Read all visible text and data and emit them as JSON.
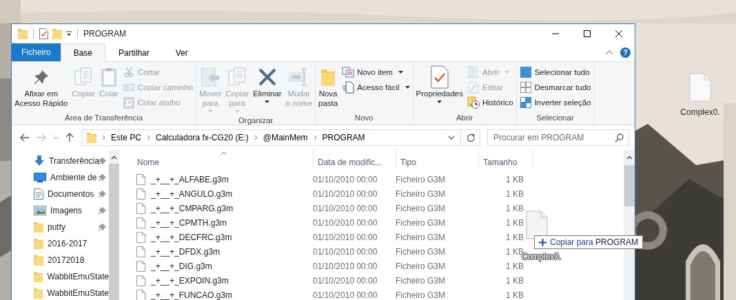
{
  "window": {
    "title": "PROGRAM"
  },
  "ribbon_tabs": [
    {
      "label": "Ficheiro",
      "kind": "file",
      "selected": false
    },
    {
      "label": "Base",
      "kind": "tab",
      "selected": true
    },
    {
      "label": "Partilhar",
      "kind": "tab",
      "selected": false
    },
    {
      "label": "Ver",
      "kind": "tab",
      "selected": false
    }
  ],
  "help": {
    "label": "?"
  },
  "ribbon_groups": [
    {
      "label": "Área de Transferência",
      "items": [
        {
          "kind": "large",
          "label": "Afixar em\nAcesso Rápido",
          "disabled": false,
          "dropdown": false
        },
        {
          "kind": "large",
          "label": "Copiar",
          "disabled": true,
          "dropdown": false
        },
        {
          "kind": "large",
          "label": "Colar",
          "disabled": true,
          "dropdown": false
        },
        {
          "kind": "small",
          "label": "Cortar",
          "disabled": true,
          "dropdown": false
        },
        {
          "kind": "small",
          "label": "Copiar caminho",
          "disabled": true,
          "dropdown": false
        },
        {
          "kind": "small",
          "label": "Colar atalho",
          "disabled": true,
          "dropdown": false
        }
      ]
    },
    {
      "label": "Organizar",
      "items": [
        {
          "kind": "large",
          "label": "Mover\npara",
          "disabled": true,
          "dropdown": true
        },
        {
          "kind": "large",
          "label": "Copiar\npara",
          "disabled": true,
          "dropdown": true
        },
        {
          "kind": "large",
          "label": "Eliminar",
          "disabled": false,
          "dropdown": true
        },
        {
          "kind": "large",
          "label": "Mudar\no nome",
          "disabled": true,
          "dropdown": false
        }
      ]
    },
    {
      "label": "Novo",
      "items": [
        {
          "kind": "large",
          "label": "Nova\npasta",
          "disabled": false,
          "dropdown": false
        },
        {
          "kind": "small",
          "label": "Novo item",
          "disabled": false,
          "dropdown": true
        },
        {
          "kind": "small",
          "label": "Acesso fácil",
          "disabled": false,
          "dropdown": true
        }
      ]
    },
    {
      "label": "Abrir",
      "items": [
        {
          "kind": "large",
          "label": "Propriedades",
          "disabled": false,
          "dropdown": true
        },
        {
          "kind": "small",
          "label": "Abrir",
          "disabled": true,
          "dropdown": true
        },
        {
          "kind": "small",
          "label": "Editar",
          "disabled": true,
          "dropdown": false
        },
        {
          "kind": "small",
          "label": "Histórico",
          "disabled": false,
          "dropdown": false
        }
      ]
    },
    {
      "label": "Selecionar",
      "items": [
        {
          "kind": "small",
          "label": "Selecionar tudo",
          "disabled": false,
          "dropdown": false
        },
        {
          "kind": "small",
          "label": "Desmarcar tudo",
          "disabled": false,
          "dropdown": false
        },
        {
          "kind": "small",
          "label": "Inverter seleção",
          "disabled": false,
          "dropdown": false
        }
      ]
    }
  ],
  "address": {
    "crumbs": [
      "Este PC",
      "Calculadora fx-CG20 (E:)",
      "@MainMem",
      "PROGRAM"
    ]
  },
  "search": {
    "placeholder": "Procurar em PROGRAM"
  },
  "nav_items": [
    {
      "label": "Transferência",
      "kind": "download",
      "pinned": true
    },
    {
      "label": "Ambiente de",
      "kind": "desktop",
      "pinned": true
    },
    {
      "label": "Documentos",
      "kind": "documents",
      "pinned": true
    },
    {
      "label": "Imagens",
      "kind": "pictures",
      "pinned": true
    },
    {
      "label": "putty",
      "kind": "folder",
      "pinned": true
    },
    {
      "label": "2016-2017",
      "kind": "folder",
      "pinned": false
    },
    {
      "label": "20172018",
      "kind": "folder",
      "pinned": false
    },
    {
      "label": "WabbitEmuState",
      "kind": "folder",
      "pinned": false
    },
    {
      "label": "WabbitEmuState",
      "kind": "folder",
      "pinned": false
    }
  ],
  "table": {
    "columns": [
      {
        "label": "Nome",
        "sorted": true
      },
      {
        "label": "Data de modific...",
        "sorted": false
      },
      {
        "label": "Tipo",
        "sorted": false
      },
      {
        "label": "Tamanho",
        "sorted": false
      }
    ],
    "rows": [
      {
        "name": "_+__+_ALFABE.g3m",
        "date": "01/10/2010 00:00",
        "type": "Ficheiro G3M",
        "size": "1 KB"
      },
      {
        "name": "_+__+_ANGULO.g3m",
        "date": "01/10/2010 00:00",
        "type": "Ficheiro G3M",
        "size": "1 KB"
      },
      {
        "name": "_+__+_CMPARG.g3m",
        "date": "01/10/2010 00:00",
        "type": "Ficheiro G3M",
        "size": "1 KB"
      },
      {
        "name": "_+__+_CPMTH.g3m",
        "date": "01/10/2010 00:00",
        "type": "Ficheiro G3M",
        "size": "1 KB"
      },
      {
        "name": "_+__+_DECFRC.g3m",
        "date": "01/10/2010 00:00",
        "type": "Ficheiro G3M",
        "size": "1 KB"
      },
      {
        "name": "_+__+_DFDX.g3m",
        "date": "01/10/2010 00:00",
        "type": "Ficheiro G3M",
        "size": "1 KB"
      },
      {
        "name": "_+__+_DIG.g3m",
        "date": "01/10/2010 00:00",
        "type": "Ficheiro G3M",
        "size": "1 KB"
      },
      {
        "name": "_+__+_EXPOIN.g3m",
        "date": "01/10/2010 00:00",
        "type": "Ficheiro G3M",
        "size": "1 KB"
      },
      {
        "name": "_+__+_FUNCAO.g3m",
        "date": "01/10/2010 00:00",
        "type": "Ficheiro G3M",
        "size": "1 KB"
      }
    ]
  },
  "drag": {
    "label": "Complex0.",
    "action": "Copiar para",
    "target": "PROGRAM"
  },
  "desktop_icons": [
    {
      "label": "Complex0."
    }
  ]
}
